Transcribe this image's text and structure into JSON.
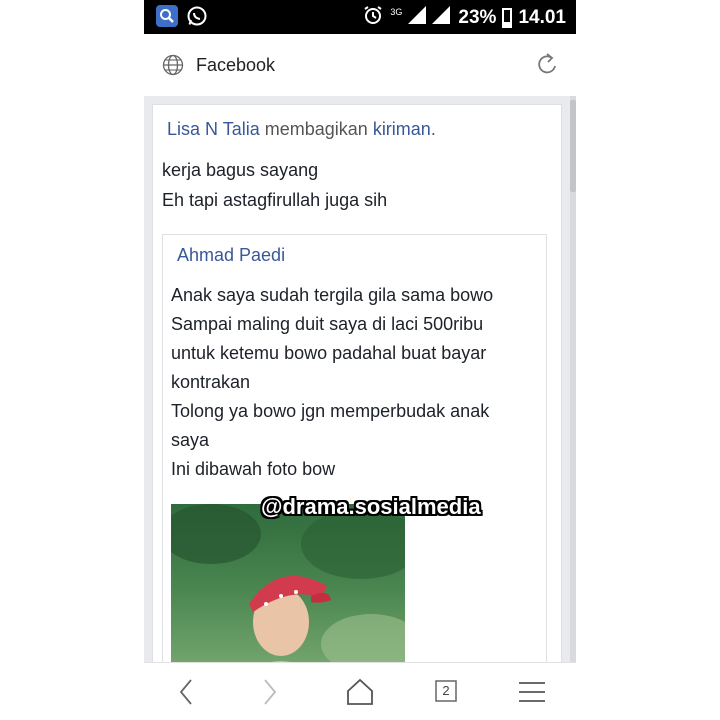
{
  "status_bar": {
    "network_label": "3G",
    "battery_percent": "23%",
    "time": "14.01"
  },
  "address_bar": {
    "title": "Facebook"
  },
  "post": {
    "sharer_name": "Lisa N Talia",
    "share_verb": "membagikan",
    "share_object": "kiriman",
    "share_suffix": ".",
    "lines": [
      "kerja bagus sayang",
      "Eh tapi astagfirullah juga sih"
    ]
  },
  "shared_post": {
    "author": "Ahmad Paedi",
    "paragraphs": [
      "Anak saya sudah tergila gila sama bowo",
      "Sampai maling duit saya di laci 500ribu untuk ketemu bowo padahal buat bayar kontrakan",
      "Tolong ya bowo jgn memperbudak anak saya",
      "Ini dibawah foto bow"
    ]
  },
  "watermark": "@drama.sosialmedia",
  "bottom_nav": {
    "tab_count": "2"
  },
  "icons": {
    "status": [
      "search-icon",
      "whatsapp-icon",
      "alarm-icon",
      "signal-icon",
      "battery-icon"
    ],
    "address": [
      "globe-icon",
      "reload-icon"
    ],
    "nav": [
      "back-icon",
      "forward-icon",
      "home-icon",
      "tabs-icon",
      "menu-icon"
    ]
  }
}
